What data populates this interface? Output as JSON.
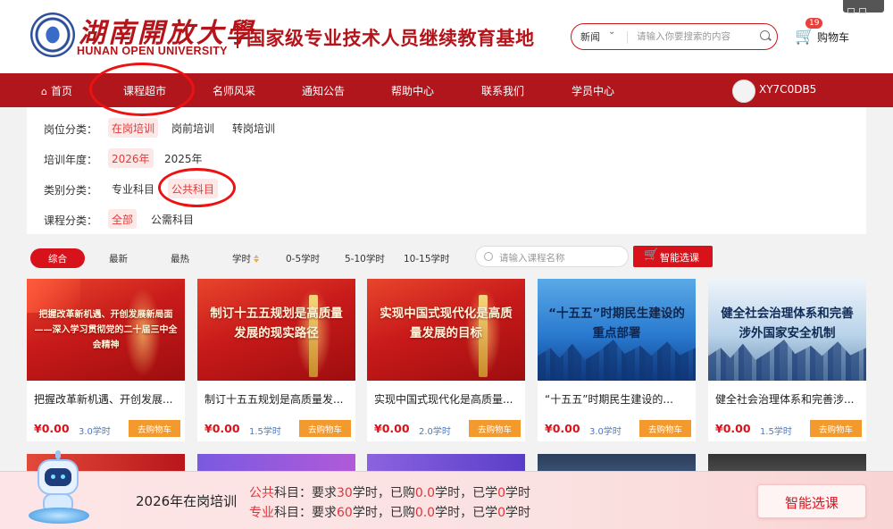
{
  "header": {
    "logo_cn": "湖南開放大學",
    "logo_en": "HUNAN OPEN UNIVERSITY",
    "site_title": "国家级专业技术人员继续教育基地",
    "search": {
      "scope": "新闻",
      "placeholder": "请输入你要搜索的内容"
    },
    "cart": {
      "count": "19",
      "label": "购物车"
    }
  },
  "nav": {
    "items": [
      "首页",
      "课程超市",
      "名师风采",
      "通知公告",
      "帮助中心",
      "联系我们",
      "学员中心"
    ],
    "active": "课程超市",
    "username": "XY7C0DB5"
  },
  "filters": [
    {
      "label": "岗位分类：",
      "options": [
        "在岗培训",
        "岗前培训",
        "转岗培训"
      ],
      "active": "在岗培训"
    },
    {
      "label": "培训年度：",
      "options": [
        "2026年",
        "2025年"
      ],
      "active": "2026年"
    },
    {
      "label": "类别分类：",
      "options": [
        "专业科目",
        "公共科目"
      ],
      "active": "公共科目"
    },
    {
      "label": "课程分类：",
      "options": [
        "全部",
        "公需科目"
      ],
      "active": "全部"
    }
  ],
  "sort": {
    "items": [
      "综合",
      "最新",
      "最热",
      "学时",
      "0-5学时",
      "5-10学时",
      "10-15学时"
    ],
    "active": "综合",
    "search_placeholder": "请输入课程名称",
    "smart_button": "智能选课"
  },
  "courses": [
    {
      "thumb_title": "把握改革新机遇、开创发展新局面——深入学习贯彻党的二十届三中全会精神",
      "name": "把握改革新机遇、开创发展...",
      "price": "¥0.00",
      "hours": "3.0学时",
      "cart_label": "去购物车",
      "theme": "red"
    },
    {
      "thumb_title": "制订十五五规划是高质量发展的现实路径",
      "name": "制订十五五规划是高质量发...",
      "price": "¥0.00",
      "hours": "1.5学时",
      "cart_label": "去购物车",
      "theme": "red"
    },
    {
      "thumb_title": "实现中国式现代化是高质量发展的目标",
      "name": "实现中国式现代化是高质量...",
      "price": "¥0.00",
      "hours": "2.0学时",
      "cart_label": "去购物车",
      "theme": "red"
    },
    {
      "thumb_title": "“十五五”时期民生建设的重点部署",
      "name": "“十五五”时期民生建设的...",
      "price": "¥0.00",
      "hours": "3.0学时",
      "cart_label": "去购物车",
      "theme": "blue"
    },
    {
      "thumb_title": "健全社会治理体系和完善涉外国家安全机制",
      "name": "健全社会治理体系和完善涉...",
      "price": "¥0.00",
      "hours": "1.5学时",
      "cart_label": "去购物车",
      "theme": "city"
    }
  ],
  "footer": {
    "title": "2026年在岗培训",
    "lines": [
      {
        "category": "公共",
        "rest": "科目：要求",
        "required": "30",
        "bought_label": "学时，已购",
        "bought": "0.0",
        "learned_label": "学时，已学",
        "learned": "0",
        "unit": "学时"
      },
      {
        "category": "专业",
        "rest": "科目：要求",
        "required": "60",
        "bought_label": "学时，已购",
        "bought": "0.0",
        "learned_label": "学时，已学",
        "learned": "0",
        "unit": "学时"
      }
    ],
    "button": "智能选课"
  },
  "colors": {
    "brand_red": "#b1161c",
    "accent_red": "#d8121b",
    "orange": "#f29a2e",
    "hours_blue": "#4a7bc6",
    "annotation_red": "#e11111"
  }
}
